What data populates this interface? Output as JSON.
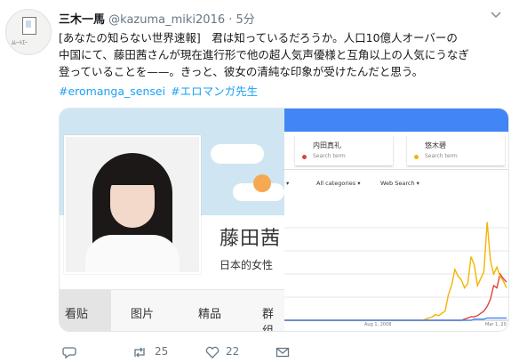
{
  "tweet": {
    "name": "三木一馬",
    "handle": "@kazuma_miki2016",
    "time": "5分",
    "lines": [
      "[あなたの知らない世界速報]　君は知っているだろうか。人口10億人オーバーの",
      "中国にて、藤田茜さんが現在進行形で他の超人気声優様と互角以上の人気にうなぎ",
      "登っていることを——。きっと、彼女の清純な印象が受けたんだと思う。"
    ],
    "hashtags": [
      "#eromanga_sensei",
      "#エロマンガ先生"
    ]
  },
  "profile": {
    "name": "藤田茜",
    "description": "日本的女性",
    "tabs": [
      "看贴",
      "图片",
      "精品",
      "群组"
    ]
  },
  "trends": {
    "terms": [
      {
        "name": "内田真礼",
        "sub": "Search term",
        "color": "#db4437"
      },
      {
        "name": "悠木碧",
        "sub": "Search term",
        "color": "#f4b400"
      }
    ],
    "filters": [
      "▾",
      "All categories ▾",
      "Web Search ▾"
    ],
    "x_labels": [
      "Aug 1, 2008",
      "Mar 1, 20"
    ]
  },
  "chart_data": {
    "type": "line",
    "title": "",
    "xlabel": "",
    "ylabel": "",
    "series": [
      {
        "name": "内田真礼",
        "color": "#db4437",
        "values": [
          0,
          0,
          0,
          0,
          0,
          0,
          0,
          0,
          0,
          0,
          0,
          0,
          0,
          0,
          0,
          0,
          0,
          0,
          0,
          0,
          0,
          0,
          0,
          0,
          0,
          0,
          0,
          0,
          0,
          0,
          0,
          1,
          2,
          3,
          3,
          4,
          6,
          8,
          12,
          18,
          30,
          28,
          40,
          36,
          33
        ]
      },
      {
        "name": "悠木碧",
        "color": "#f4b400",
        "values": [
          0,
          0,
          0,
          0,
          0,
          0,
          0,
          0,
          0,
          0,
          0,
          0,
          0,
          0,
          0,
          0,
          0,
          0,
          0,
          1,
          2,
          3,
          5,
          4,
          6,
          8,
          22,
          30,
          44,
          38,
          35,
          28,
          32,
          55,
          48,
          30,
          36,
          42,
          85,
          52,
          40,
          46,
          38,
          34,
          28
        ]
      },
      {
        "name": "",
        "color": "#4285f4",
        "values": [
          0,
          0,
          0,
          0,
          0,
          0,
          0,
          0,
          0,
          0,
          0,
          0,
          0,
          0,
          0,
          0,
          0,
          0,
          0,
          0,
          0,
          0,
          0,
          0,
          0,
          0,
          0,
          0,
          0,
          0,
          0,
          0,
          0,
          0,
          1,
          1,
          1,
          1,
          2,
          2,
          2,
          2,
          2,
          2,
          2
        ]
      }
    ],
    "ylim": [
      0,
      100
    ]
  },
  "actions": {
    "reply": "",
    "retweet_count": "25",
    "like_count": "22"
  }
}
